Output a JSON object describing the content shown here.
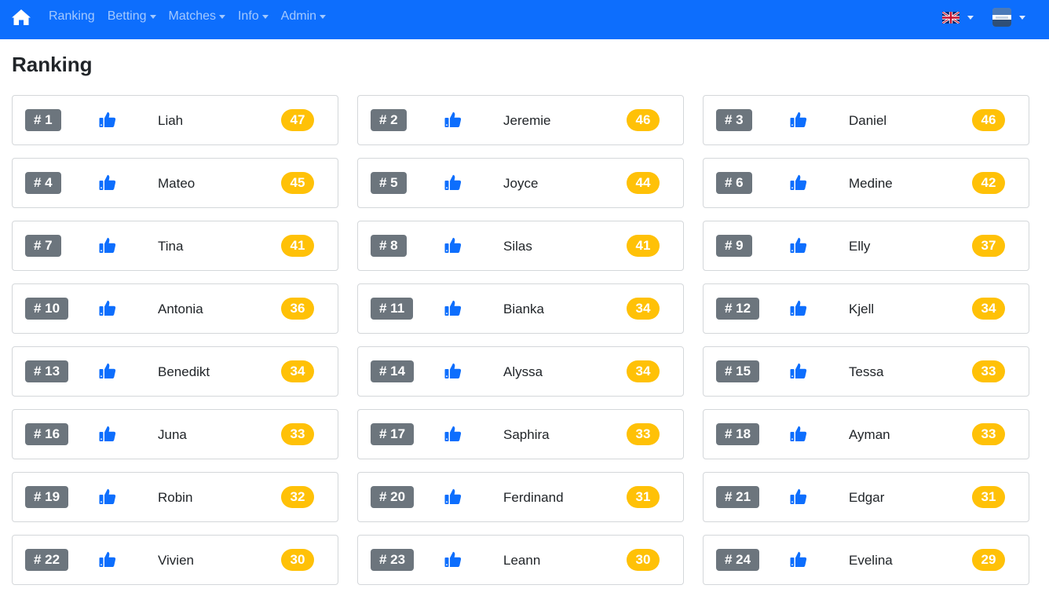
{
  "nav": {
    "home_icon": "home-icon",
    "items": [
      {
        "label": "Ranking",
        "dropdown": false
      },
      {
        "label": "Betting",
        "dropdown": true
      },
      {
        "label": "Matches",
        "dropdown": true
      },
      {
        "label": "Info",
        "dropdown": true
      },
      {
        "label": "Admin",
        "dropdown": true
      }
    ],
    "language_icon": "uk-flag-icon",
    "user_icon": "user-avatar"
  },
  "page": {
    "title": "Ranking"
  },
  "colors": {
    "navbar": "#0d6efd",
    "rank_badge": "#6c757d",
    "score_badge": "#ffc107",
    "thumb": "#0d6efd"
  },
  "ranking": [
    {
      "rank": "# 1",
      "name": "Liah",
      "points": "47"
    },
    {
      "rank": "# 2",
      "name": "Jeremie",
      "points": "46"
    },
    {
      "rank": "# 3",
      "name": "Daniel",
      "points": "46"
    },
    {
      "rank": "# 4",
      "name": "Mateo",
      "points": "45"
    },
    {
      "rank": "# 5",
      "name": "Joyce",
      "points": "44"
    },
    {
      "rank": "# 6",
      "name": "Medine",
      "points": "42"
    },
    {
      "rank": "# 7",
      "name": "Tina",
      "points": "41"
    },
    {
      "rank": "# 8",
      "name": "Silas",
      "points": "41"
    },
    {
      "rank": "# 9",
      "name": "Elly",
      "points": "37"
    },
    {
      "rank": "# 10",
      "name": "Antonia",
      "points": "36"
    },
    {
      "rank": "# 11",
      "name": "Bianka",
      "points": "34"
    },
    {
      "rank": "# 12",
      "name": "Kjell",
      "points": "34"
    },
    {
      "rank": "# 13",
      "name": "Benedikt",
      "points": "34"
    },
    {
      "rank": "# 14",
      "name": "Alyssa",
      "points": "34"
    },
    {
      "rank": "# 15",
      "name": "Tessa",
      "points": "33"
    },
    {
      "rank": "# 16",
      "name": "Juna",
      "points": "33"
    },
    {
      "rank": "# 17",
      "name": "Saphira",
      "points": "33"
    },
    {
      "rank": "# 18",
      "name": "Ayman",
      "points": "33"
    },
    {
      "rank": "# 19",
      "name": "Robin",
      "points": "32"
    },
    {
      "rank": "# 20",
      "name": "Ferdinand",
      "points": "31"
    },
    {
      "rank": "# 21",
      "name": "Edgar",
      "points": "31"
    },
    {
      "rank": "# 22",
      "name": "Vivien",
      "points": "30"
    },
    {
      "rank": "# 23",
      "name": "Leann",
      "points": "30"
    },
    {
      "rank": "# 24",
      "name": "Evelina",
      "points": "29"
    }
  ]
}
